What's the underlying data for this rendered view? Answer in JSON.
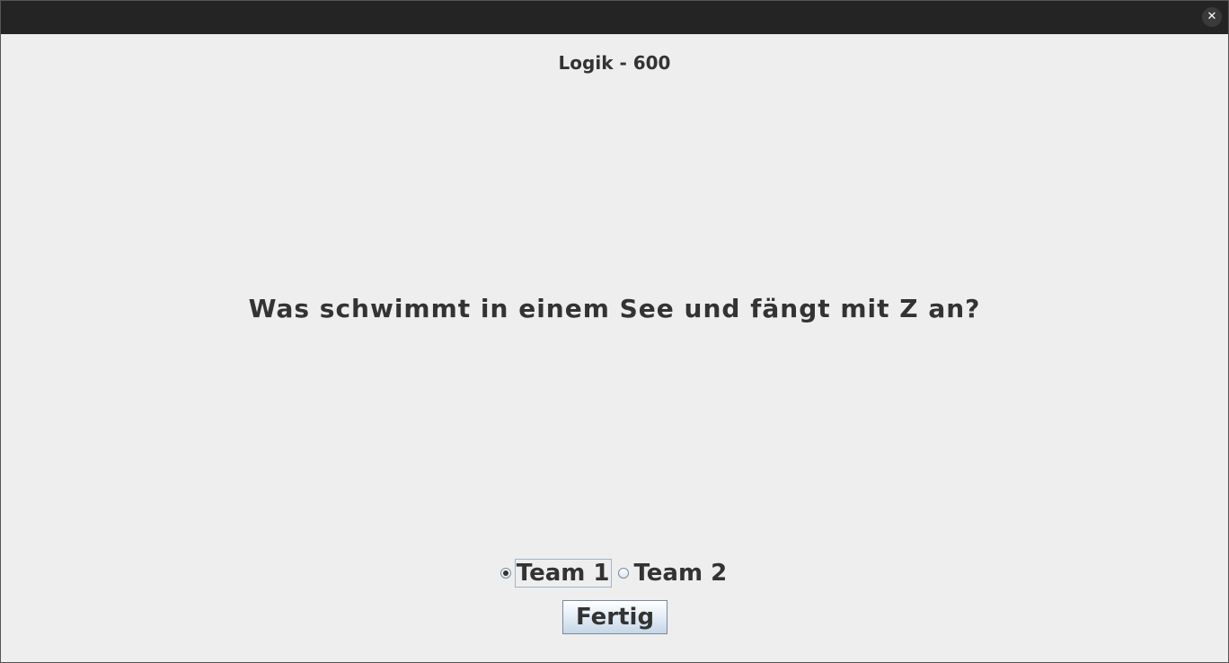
{
  "window": {
    "close_symbol": "✕"
  },
  "header": {
    "category_title": "Logik - 600"
  },
  "main": {
    "question": "Was schwimmt in einem See und fängt mit Z an?"
  },
  "teams": {
    "options": [
      {
        "label": "Team 1",
        "selected": true
      },
      {
        "label": "Team 2",
        "selected": false
      }
    ]
  },
  "actions": {
    "done_label": "Fertig"
  },
  "colors": {
    "titlebar": "#242424",
    "background": "#eeeeee",
    "text": "#333333"
  }
}
